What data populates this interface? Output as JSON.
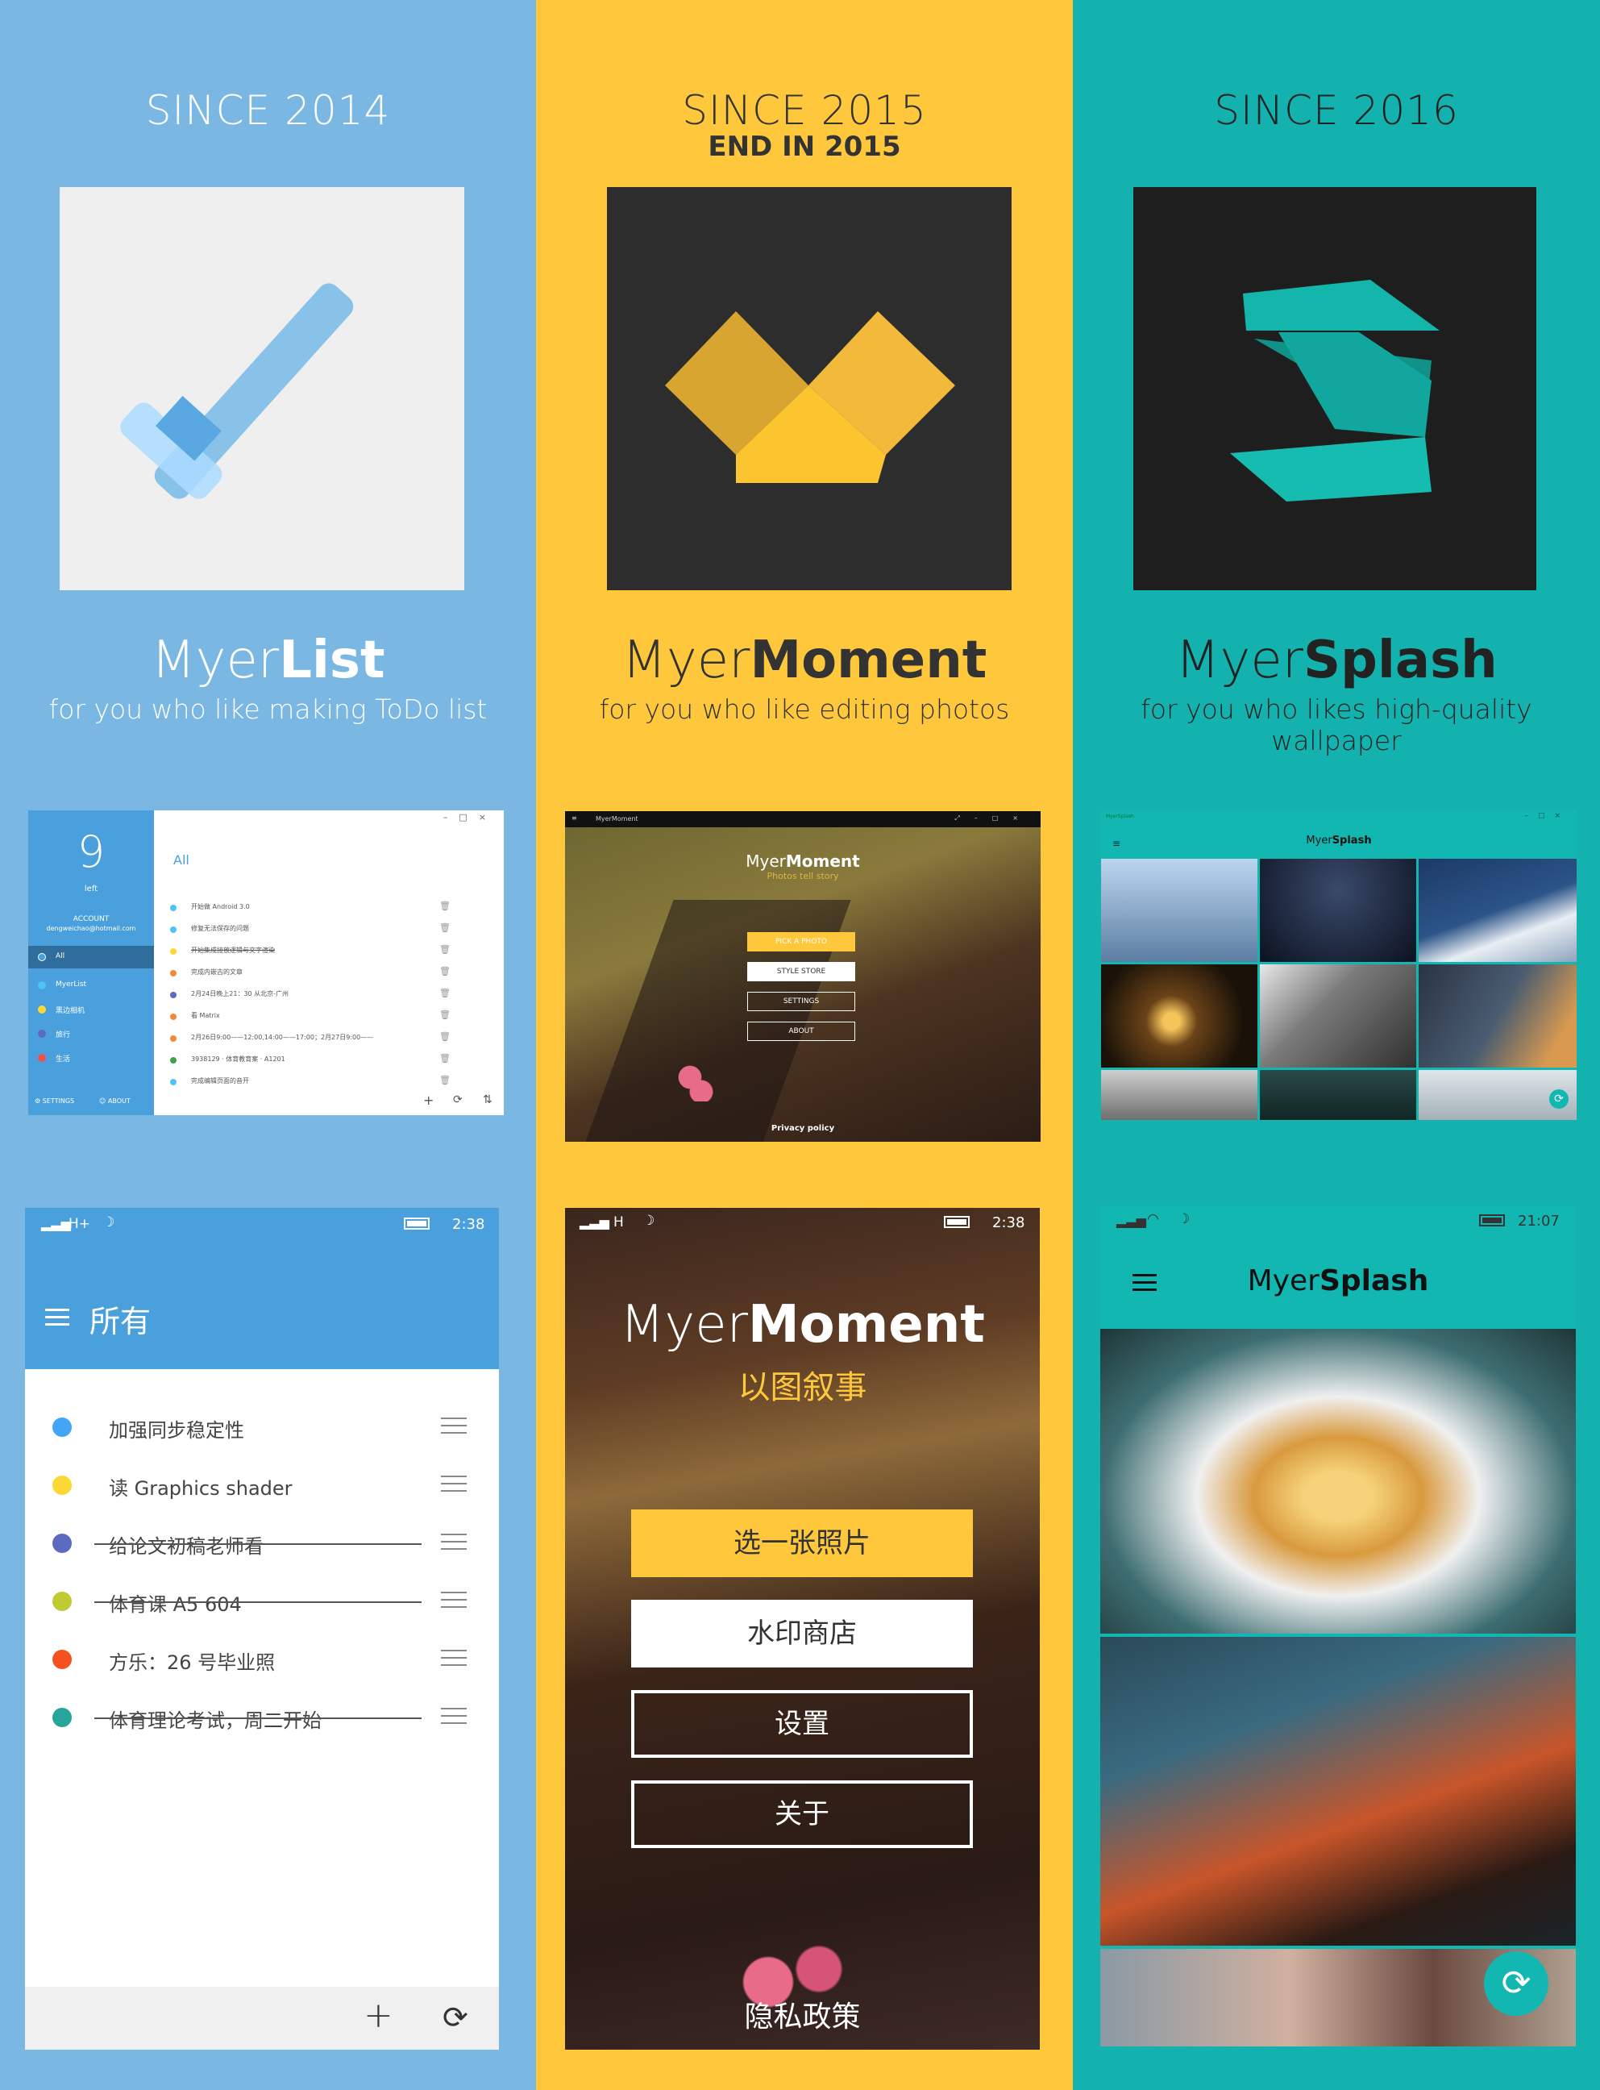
{
  "colors": {
    "myerlist_bg": "#7ab8e3",
    "myermoment_bg": "#ffc83c",
    "myersplash_bg": "#13b2ae",
    "list_blue": "#4aa0dc",
    "splash_teal": "#12b7b2"
  },
  "apps": [
    {
      "since": "SINCE 2014",
      "end": "",
      "name_light": "Myer",
      "name_bold": "List",
      "tagline": "for you who like making ToDo list"
    },
    {
      "since": "SINCE 2015",
      "end": "END IN 2015",
      "name_light": "Myer",
      "name_bold": "Moment",
      "tagline": "for you who like editing photos"
    },
    {
      "since": "SINCE 2016",
      "end": "",
      "name_light": "Myer",
      "name_bold": "Splash",
      "tagline": "for you who likes high-quality wallpaper"
    }
  ],
  "myerlist_desktop": {
    "count": "9",
    "count_label": "left",
    "account_label": "ACCOUNT",
    "account_email": "dengweichao@hotmail.com",
    "nav": [
      {
        "label": "All",
        "color": "#4aa0dc"
      },
      {
        "label": "MyerList",
        "color": "#4fc3f7"
      },
      {
        "label": "黑边相机",
        "color": "#fdd835"
      },
      {
        "label": "旅行",
        "color": "#5c6bc0"
      },
      {
        "label": "生活",
        "color": "#ef5350"
      }
    ],
    "settings_label": "SETTINGS",
    "about_label": "ABOUT",
    "header": "All",
    "window_controls": [
      "–",
      "□",
      "×"
    ],
    "items": [
      {
        "text": "开始做 Android 3.0",
        "color": "#4fc3f7",
        "done": false
      },
      {
        "text": "修复无法保存的问题",
        "color": "#4fc3f7",
        "done": false
      },
      {
        "text": "开始集成接放逻辑与文字渲染",
        "color": "#fdd835",
        "done": true
      },
      {
        "text": "完成内嵌古的文章",
        "color": "#ef8a3c",
        "done": false
      },
      {
        "text": "2月24日晚上21：30 从北京-广州",
        "color": "#5c6bc0",
        "done": false
      },
      {
        "text": "看 Matrix",
        "color": "#ef8a3c",
        "done": false
      },
      {
        "text": "2月26日9:00——12:00,14:00——17:00；2月27日9:00——",
        "color": "#ef8a3c",
        "done": false
      },
      {
        "text": "3938129 · 体育教育案 · A1201",
        "color": "#43a047",
        "done": false
      },
      {
        "text": "完成编辑页面的音开",
        "color": "#4fc3f7",
        "done": false
      }
    ],
    "bottom_icons": [
      "+",
      "⟳",
      "⇅"
    ]
  },
  "myermoment_desktop": {
    "window_title": "MyerMoment",
    "title_light": "Myer",
    "title_bold": "Moment",
    "subtitle": "Photos tell story",
    "buttons": [
      "PICK A PHOTO",
      "STYLE STORE",
      "SETTINGS",
      "ABOUT"
    ],
    "privacy": "Privacy policy"
  },
  "myersplash_desktop": {
    "window_title": "MyerSplash",
    "title_light": "Myer",
    "title_bold": "Splash"
  },
  "myerlist_phone": {
    "status_net": "H+",
    "time": "2:38",
    "title": "所有",
    "items": [
      {
        "text": "加强同步稳定性",
        "color": "#42a5f5",
        "done": false
      },
      {
        "text": "读 Graphics shader",
        "color": "#fdd835",
        "done": false
      },
      {
        "text": "给论文初稿老师看",
        "color": "#5c6bc0",
        "done": true
      },
      {
        "text": "体育课 A5 604",
        "color": "#c0ca33",
        "done": true
      },
      {
        "text": "方乐：26 号毕业照",
        "color": "#f4511e",
        "done": false
      },
      {
        "text": "体育理论考试，周二开始",
        "color": "#26a69a",
        "done": true
      }
    ],
    "add_icon": "+",
    "sync_icon": "⟳"
  },
  "myermoment_phone": {
    "status_net": "H",
    "time": "2:38",
    "title_light": "Myer",
    "title_bold": "Moment",
    "subtitle": "以图叙事",
    "buttons": [
      "选一张照片",
      "水印商店",
      "设置",
      "关于"
    ],
    "privacy": "隐私政策"
  },
  "myersplash_phone": {
    "time": "21:07",
    "title_light": "Myer",
    "title_bold": "Splash",
    "refresh_icon": "⟳"
  }
}
